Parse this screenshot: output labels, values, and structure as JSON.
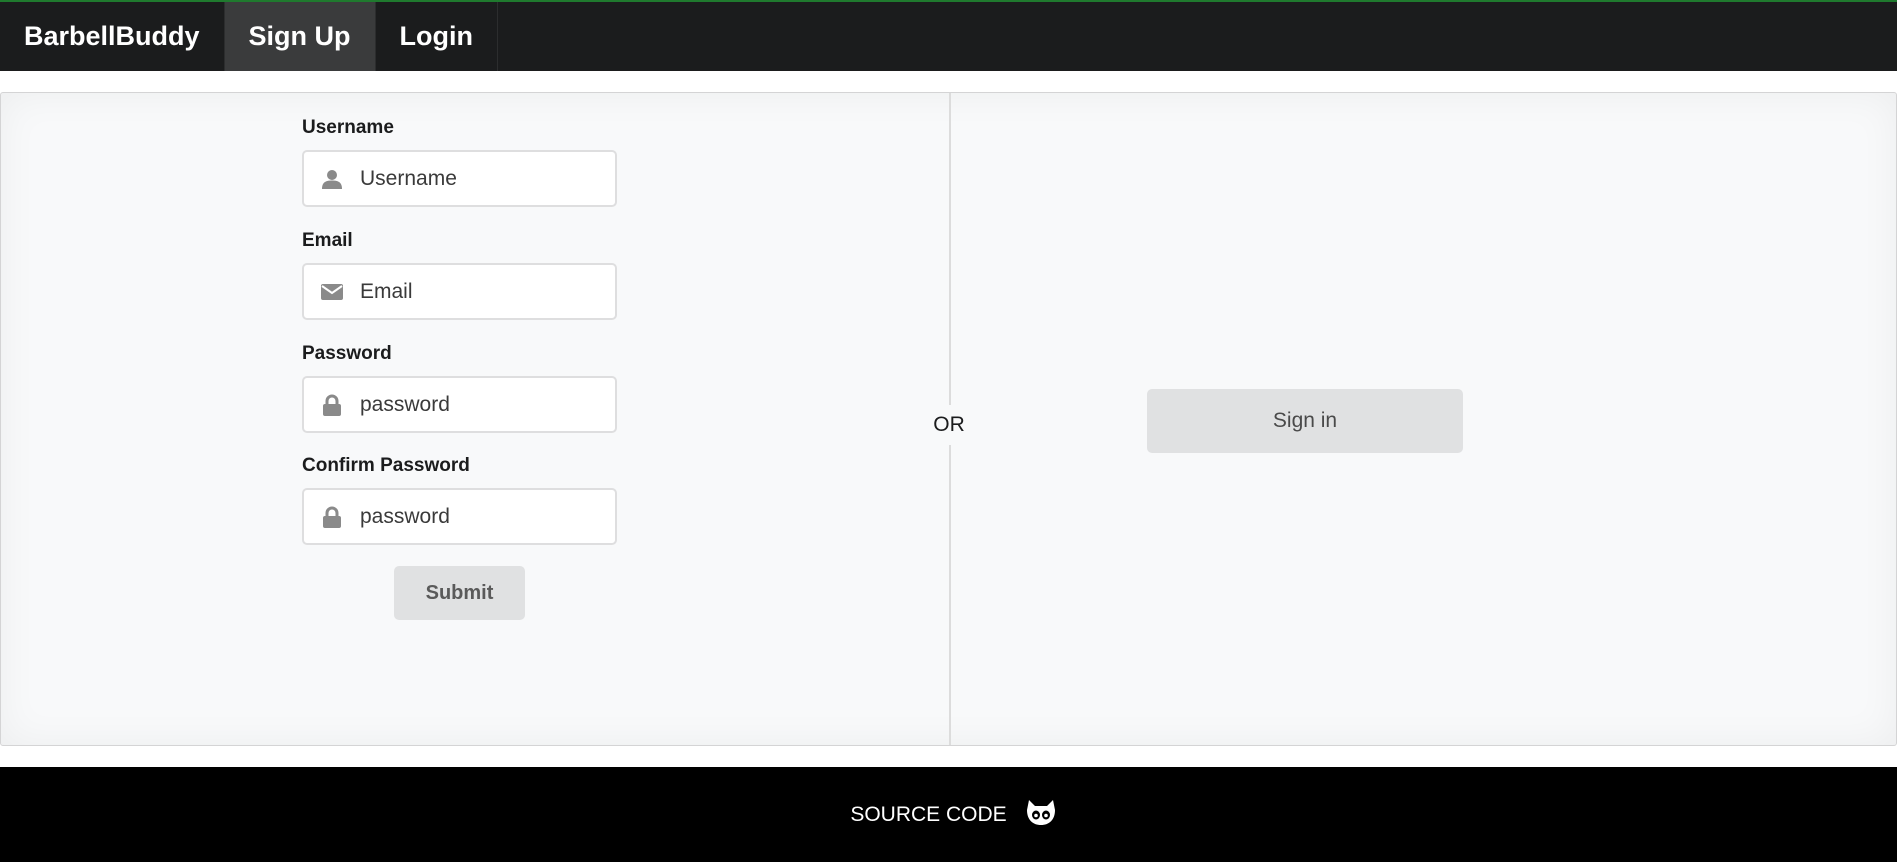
{
  "nav": {
    "brand": "BarbellBuddy",
    "items": [
      {
        "label": "Sign Up",
        "active": true
      },
      {
        "label": "Login",
        "active": false
      }
    ]
  },
  "signup_form": {
    "username": {
      "label": "Username",
      "placeholder": "Username",
      "icon": "user-icon"
    },
    "email": {
      "label": "Email",
      "placeholder": "Email",
      "icon": "envelope-icon"
    },
    "password": {
      "label": "Password",
      "placeholder": "password",
      "icon": "lock-icon"
    },
    "confirm_password": {
      "label": "Confirm Password",
      "placeholder": "password",
      "icon": "lock-icon"
    },
    "submit_label": "Submit"
  },
  "divider_label": "OR",
  "signin": {
    "label": "Sign in"
  },
  "footer": {
    "link_label": "SOURCE CODE",
    "icon": "github-icon"
  },
  "colors": {
    "topbar": "#1b1c1d",
    "active_nav": "#3a3b3c",
    "panel": "#f8f9fa",
    "button": "#e0e1e2",
    "footer": "#000000",
    "topbar_accent": "#1f7a2e"
  }
}
